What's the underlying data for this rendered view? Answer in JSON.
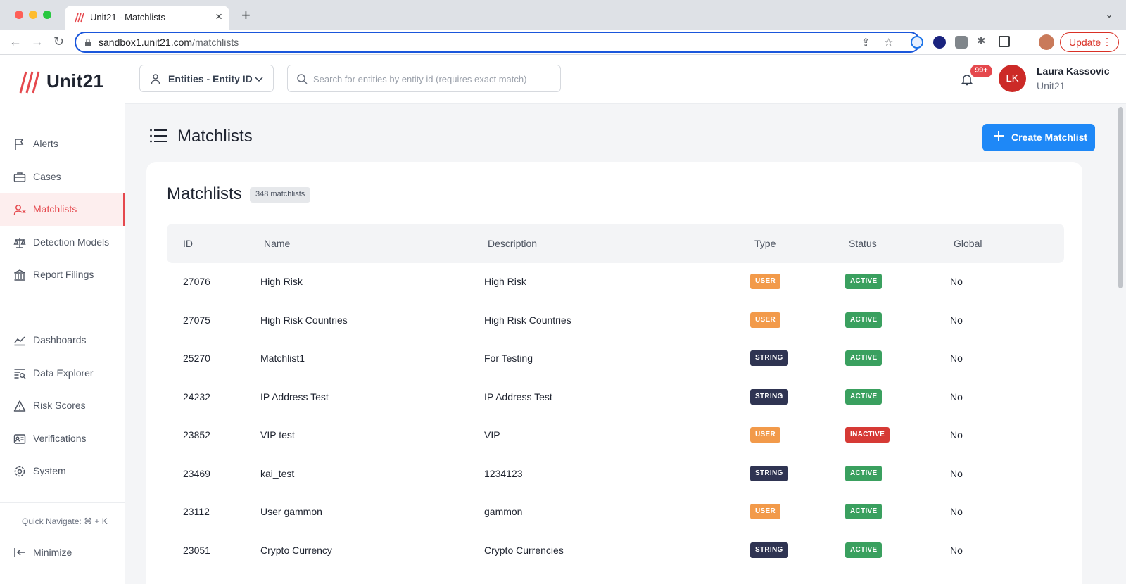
{
  "browser": {
    "tab_title": "Unit21 - Matchlists",
    "url_host": "sandbox1.unit21.com",
    "url_path": "/matchlists",
    "update_label": "Update"
  },
  "sidebar": {
    "logo_text": "Unit21",
    "items": [
      {
        "label": "Alerts",
        "icon": "flag-icon"
      },
      {
        "label": "Cases",
        "icon": "briefcase-icon"
      },
      {
        "label": "Matchlists",
        "icon": "user-x-icon",
        "active": true
      },
      {
        "label": "Detection Models",
        "icon": "scale-icon"
      },
      {
        "label": "Report Filings",
        "icon": "bank-icon"
      },
      {
        "label": "Dashboards",
        "icon": "chart-line-icon"
      },
      {
        "label": "Data Explorer",
        "icon": "table-search-icon"
      },
      {
        "label": "Risk Scores",
        "icon": "warning-icon"
      },
      {
        "label": "Verifications",
        "icon": "id-card-icon"
      },
      {
        "label": "System",
        "icon": "gear-icon"
      }
    ],
    "quick_navigate": "Quick Navigate: ⌘ + K",
    "minimize_label": "Minimize"
  },
  "topbar": {
    "entity_select_label": "Entities - Entity ID",
    "search_placeholder": "Search for entities by entity id (requires exact match)",
    "notification_count": "99+",
    "user_initials": "LK",
    "user_name": "Laura Kassovic",
    "user_org": "Unit21"
  },
  "page": {
    "title": "Matchlists",
    "create_button": "Create Matchlist",
    "card_title": "Matchlists",
    "count_badge": "348 matchlists"
  },
  "table": {
    "columns": [
      "ID",
      "Name",
      "Description",
      "Type",
      "Status",
      "Global"
    ],
    "rows": [
      {
        "id": "27076",
        "name": "High Risk",
        "description": "High Risk",
        "type": "USER",
        "status": "ACTIVE",
        "global": "No"
      },
      {
        "id": "27075",
        "name": "High Risk Countries",
        "description": "High Risk Countries",
        "type": "USER",
        "status": "ACTIVE",
        "global": "No"
      },
      {
        "id": "25270",
        "name": "Matchlist1",
        "description": "For Testing",
        "type": "STRING",
        "status": "ACTIVE",
        "global": "No"
      },
      {
        "id": "24232",
        "name": "IP Address Test",
        "description": "IP Address Test",
        "type": "STRING",
        "status": "ACTIVE",
        "global": "No"
      },
      {
        "id": "23852",
        "name": "VIP test",
        "description": "VIP",
        "type": "USER",
        "status": "INACTIVE",
        "global": "No"
      },
      {
        "id": "23469",
        "name": "kai_test",
        "description": "1234123",
        "type": "STRING",
        "status": "ACTIVE",
        "global": "No"
      },
      {
        "id": "23112",
        "name": "User gammon",
        "description": "gammon",
        "type": "USER",
        "status": "ACTIVE",
        "global": "No"
      },
      {
        "id": "23051",
        "name": "Crypto Currency",
        "description": "Crypto Currencies",
        "type": "STRING",
        "status": "ACTIVE",
        "global": "No"
      }
    ]
  },
  "colors": {
    "brand_red": "#e5484d",
    "primary_blue": "#1e88f7",
    "user_pill": "#f29a4a",
    "string_pill": "#2f3452",
    "active_pill": "#3aa05f",
    "inactive_pill": "#d63a35"
  }
}
